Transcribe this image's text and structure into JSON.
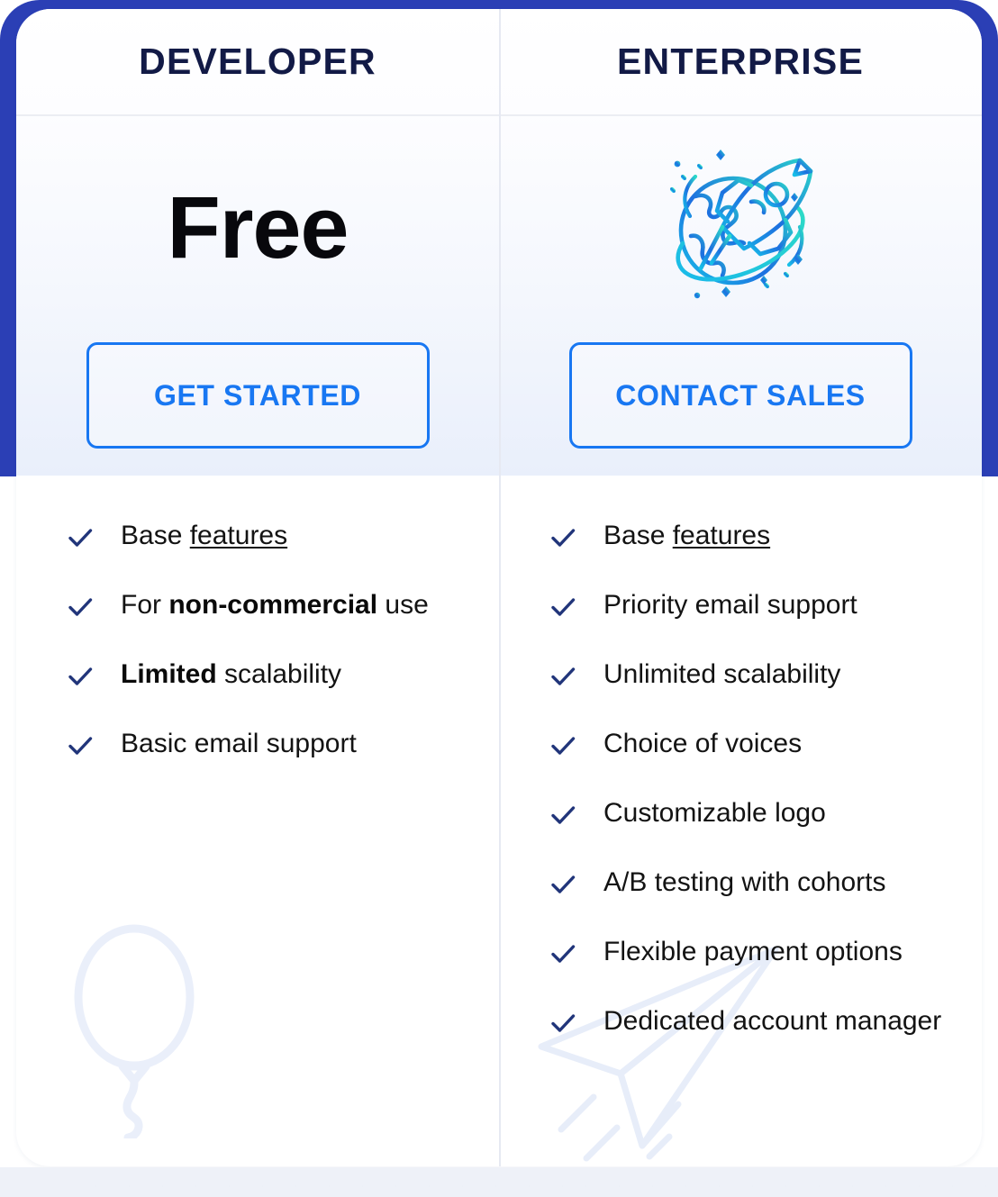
{
  "theme": {
    "frame_blue": "#2b3fb5",
    "cta_blue": "#1877f2",
    "check_navy": "#21357a",
    "heading_navy": "#121a46",
    "band_gradient_end": "#e9effb"
  },
  "plans": [
    {
      "name": "DEVELOPER",
      "price": "Free",
      "media_type": "price-text",
      "cta_label": "GET STARTED",
      "watermark": "balloon-watermark",
      "features": [
        {
          "parts": [
            {
              "t": "Base ",
              "style": "normal"
            },
            {
              "t": "features",
              "style": "link"
            }
          ]
        },
        {
          "parts": [
            {
              "t": "For ",
              "style": "normal"
            },
            {
              "t": "non-commercial",
              "style": "bold"
            },
            {
              "t": " use",
              "style": "normal"
            }
          ]
        },
        {
          "parts": [
            {
              "t": "Limited",
              "style": "bold"
            },
            {
              "t": " scalability",
              "style": "normal"
            }
          ]
        },
        {
          "parts": [
            {
              "t": "Basic email support",
              "style": "normal"
            }
          ]
        }
      ]
    },
    {
      "name": "ENTERPRISE",
      "price": "",
      "media_type": "rocket-globe-illustration",
      "cta_label": "CONTACT SALES",
      "watermark": "paper-plane-watermark",
      "features": [
        {
          "parts": [
            {
              "t": "Base ",
              "style": "normal"
            },
            {
              "t": "features",
              "style": "link"
            }
          ]
        },
        {
          "parts": [
            {
              "t": "Priority email support",
              "style": "normal"
            }
          ]
        },
        {
          "parts": [
            {
              "t": "Unlimited scalability",
              "style": "normal"
            }
          ]
        },
        {
          "parts": [
            {
              "t": "Choice of voices",
              "style": "normal"
            }
          ]
        },
        {
          "parts": [
            {
              "t": "Customizable logo",
              "style": "normal"
            }
          ]
        },
        {
          "parts": [
            {
              "t": "A/B testing with cohorts",
              "style": "normal"
            }
          ]
        },
        {
          "parts": [
            {
              "t": "Flexible payment options",
              "style": "normal"
            }
          ]
        },
        {
          "parts": [
            {
              "t": "Dedicated account manager",
              "style": "normal"
            }
          ],
          "wrap": true
        }
      ]
    }
  ],
  "icons": {
    "check": "check-icon",
    "illustration": "rocket-globe-icon",
    "balloon": "balloon-icon",
    "plane": "paper-plane-icon"
  }
}
